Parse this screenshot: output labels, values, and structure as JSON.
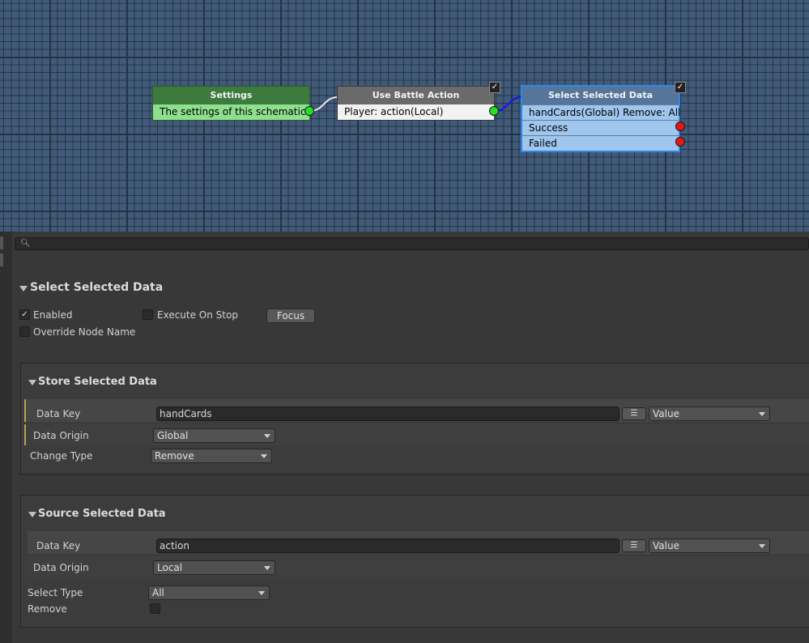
{
  "graph": {
    "nodes": {
      "settings": {
        "title": "Settings",
        "row": "The settings of this schematic."
      },
      "battle_action": {
        "title": "Use Battle Action",
        "row": "Player: action(Local)"
      },
      "select_data": {
        "title": "Select Selected Data",
        "row_main": "handCards(Global) Remove: All",
        "row_success": "Success",
        "row_failed": "Failed"
      }
    },
    "colors": {
      "settings_header": "#3d7a3d",
      "selected_border": "#2f88e8",
      "port_ok": "#22e022",
      "port_fail": "#e01818"
    }
  },
  "search": {
    "value": ""
  },
  "inspector": {
    "title": "Select Selected Data",
    "enabled_label": "Enabled",
    "enabled_checked": true,
    "execute_on_stop_label": "Execute On Stop",
    "override_label": "Override Node Name",
    "focus_button": "Focus",
    "store": {
      "heading": "Store Selected Data",
      "data_key_label": "Data Key",
      "data_key_value": "handCards",
      "value_type": "Value",
      "data_origin_label": "Data Origin",
      "data_origin_value": "Global",
      "change_type_label": "Change Type",
      "change_type_value": "Remove"
    },
    "source": {
      "heading": "Source Selected Data",
      "data_key_label": "Data Key",
      "data_key_value": "action",
      "value_type": "Value",
      "data_origin_label": "Data Origin",
      "data_origin_value": "Local",
      "select_type_label": "Select Type",
      "select_type_value": "All",
      "remove_label": "Remove"
    }
  }
}
